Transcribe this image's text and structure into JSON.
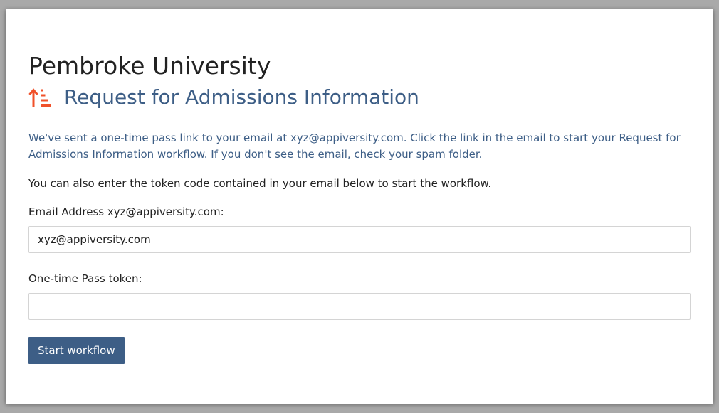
{
  "header": {
    "university_name": "Pembroke University",
    "workflow_title": "Request for Admissions Information",
    "workflow_icon": "sort-ascending-icon"
  },
  "notice": {
    "text": "We've sent a one-time pass link to your email at xyz@appiversity.com. Click the link in the email to start your Request for Admissions Information workflow. If you don't see the email, check your spam folder."
  },
  "instructions": {
    "text": "You can also enter the token code contained in your email below to start the workflow."
  },
  "form": {
    "email_label": "Email Address xyz@appiversity.com:",
    "email_value": "xyz@appiversity.com",
    "token_label": "One-time Pass token:",
    "token_value": "",
    "submit_label": "Start workflow"
  },
  "colors": {
    "accent_blue": "#3d5e86",
    "icon_orange": "#f0512a",
    "text_dark": "#222222"
  }
}
